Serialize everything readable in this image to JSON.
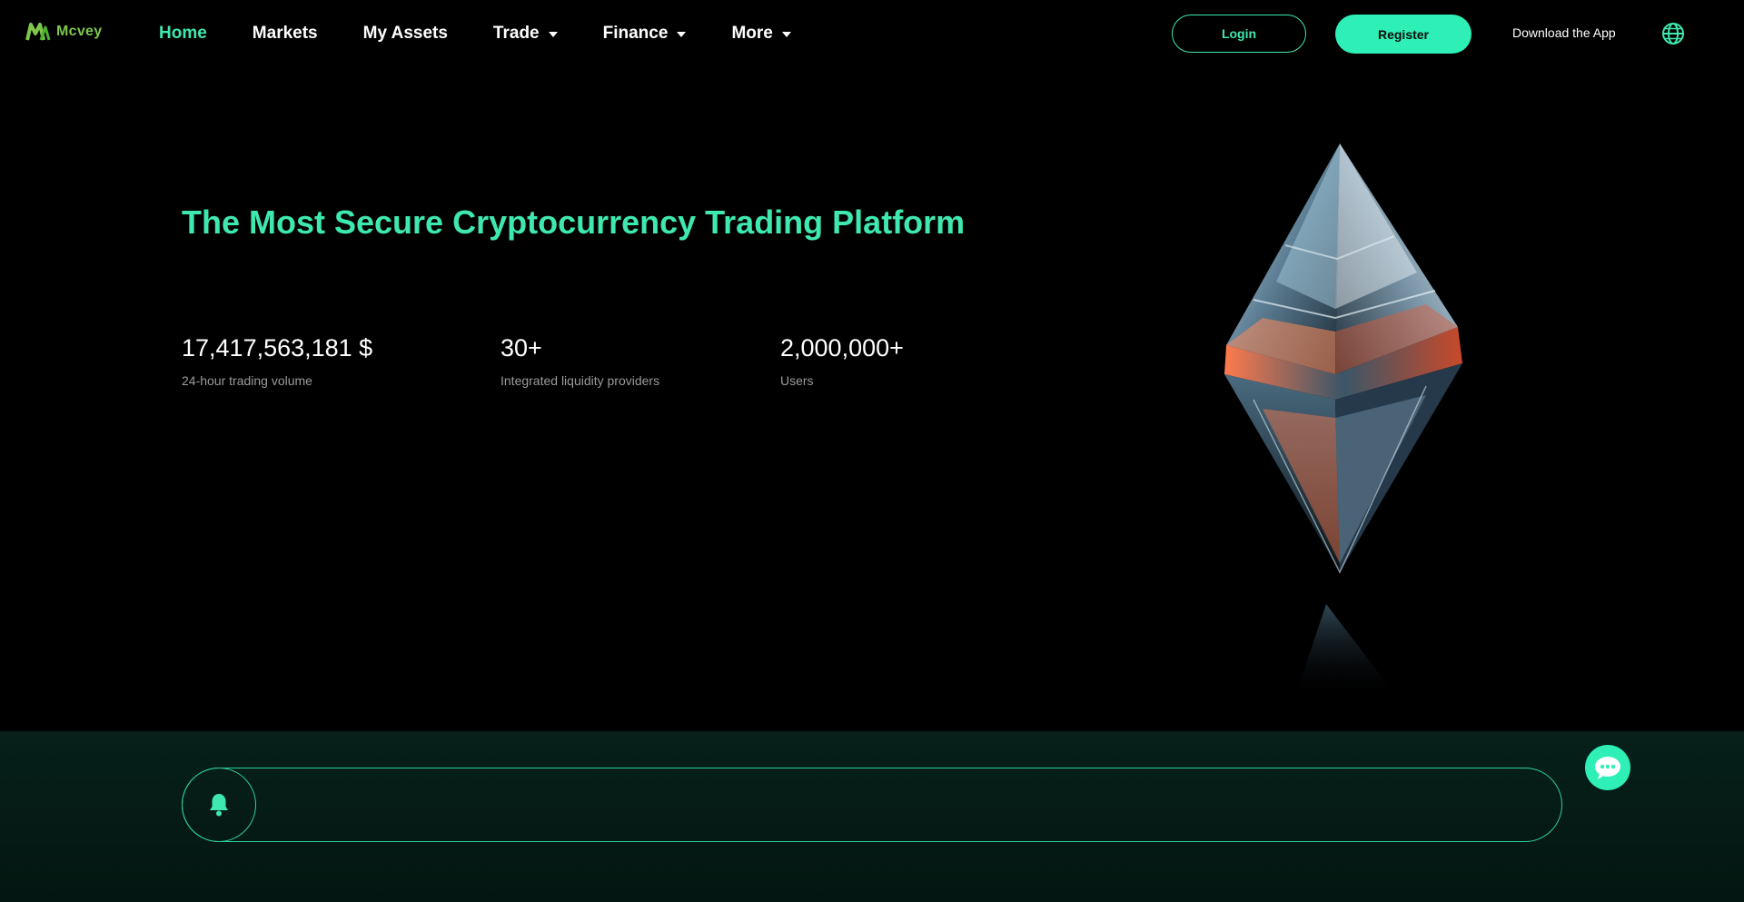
{
  "brand": {
    "name": "Mcvey",
    "logo_icon": "m-logo-icon",
    "accent": "#3ee8b0",
    "logo_color": "#7fc64a"
  },
  "nav": {
    "items": [
      {
        "label": "Home",
        "active": true,
        "dropdown": false
      },
      {
        "label": "Markets",
        "active": false,
        "dropdown": false
      },
      {
        "label": "My Assets",
        "active": false,
        "dropdown": false
      },
      {
        "label": "Trade",
        "active": false,
        "dropdown": true
      },
      {
        "label": "Finance",
        "active": false,
        "dropdown": true
      },
      {
        "label": "More",
        "active": false,
        "dropdown": true
      }
    ]
  },
  "header": {
    "login_label": "Login",
    "register_label": "Register",
    "download_label": "Download the App",
    "language_icon": "globe-icon"
  },
  "hero": {
    "title": "The Most Secure Cryptocurrency Trading Platform",
    "stats": [
      {
        "value": "17,417,563,181 $",
        "label": "24-hour trading volume"
      },
      {
        "value": "30+",
        "label": "Integrated liquidity providers"
      },
      {
        "value": "2,000,000+",
        "label": "Users"
      }
    ],
    "image_icon": "crystal-diamond-icon"
  },
  "announcement": {
    "icon": "bell-icon",
    "text": ""
  },
  "chat": {
    "icon": "chat-bubble-icon"
  }
}
